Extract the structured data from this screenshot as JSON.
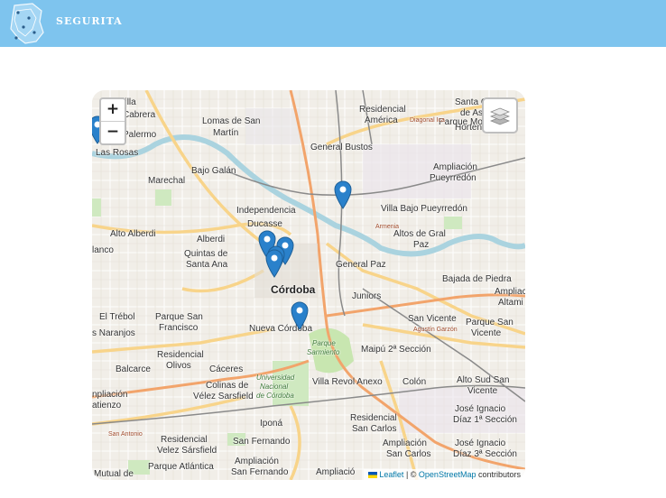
{
  "header": {
    "brand": "SEGURITA",
    "bg_color": "#7ec4ee"
  },
  "map": {
    "zoom_in_label": "+",
    "zoom_out_label": "−",
    "layers_icon": "layers-icon",
    "labels": {
      "villa": "Villa",
      "cabrera": "Cabrera",
      "palermo": "Palermo",
      "lomas": "Lomas de San",
      "martin": "Martín",
      "las_rosas": "Las Rosas",
      "bajo_galan": "Bajo Galán",
      "marechal": "Marechal",
      "residencial_america_1": "Residencial",
      "residencial_america_2": "América",
      "santa_catalina": "Santa C",
      "de_as": "de As",
      "horten": "Horten",
      "general_bustos": "General Bustos",
      "parque_montecristo": "Parque Montecristo",
      "ampliacion": "Ampliación",
      "pueyrredon": "Pueyrredón",
      "independencia": "Independencia",
      "ducasse": "Ducasse",
      "villa_bajo_pueyrredon": "Villa Bajo Pueyrredón",
      "alto_alberdi": "Alto Alberdi",
      "alberdi": "Alberdi",
      "blanco": "lanco",
      "quintas_1": "Quintas de",
      "quintas_2": "Santa Ana",
      "altos_gral_1": "Altos de Gral",
      "altos_gral_2": "Paz",
      "general_paz": "General Paz",
      "bajada": "Bajada de Piedra",
      "cordoba": "Córdoba",
      "juniors": "Juniors",
      "alta_amp_1": "Ampliac",
      "alta_amp_2": "Altami",
      "el_trebol": "El Trébol",
      "parque_san_1": "Parque San",
      "parque_san_2": "Francisco",
      "nueva_cordoba": "Nueva Córdoba",
      "san_vicente": "San Vicente",
      "parque_sv_1": "Parque San",
      "parque_sv_2": "Vicente",
      "naranjos": "s Naranjos",
      "maipu": "Maipú 2ª Sección",
      "residencial_olivos_1": "Residencial",
      "residencial_olivos_2": "Olivos",
      "balcarce": "Balcarce",
      "caceres": "Cáceres",
      "colinas_1": "Colinas de",
      "colinas_2": "Vélez Sarsfield",
      "ampliacion_w": "npliación",
      "atienzo": "atienzo",
      "villa_revol": "Villa Revol Anexo",
      "colon": "Colón",
      "alto_sud_1": "Alto Sud San",
      "alto_sud_2": "Vicente",
      "jose_ign_1": "José Ignacio",
      "jose_ign_2": "Díaz 1ª Sección",
      "ipona": "Iponá",
      "residencial_velez_1": "Residencial",
      "residencial_velez_2": "Velez Sársfield",
      "residencial_sc_1": "Residencial",
      "residencial_sc_2": "San Carlos",
      "ampl_sc_1": "Ampliación",
      "ampl_sc_2": "San Carlos",
      "jose_ign3_1": "José Ignacio",
      "jose_ign3_2": "Díaz 3ª Sección",
      "san_fernando": "San Fernando",
      "parque_atlantica": "Parque Atlántica",
      "ampl_sf_1": "Ampliación",
      "ampl_sf_2": "San Fernando",
      "mutual": "Mutual de",
      "ampliacion_bottom": "Ampliació",
      "parque_sarmiento_1": "Parque",
      "parque_sarmiento_2": "Sarmiento",
      "universidad_1": "Universidad",
      "universidad_2": "Nacional",
      "universidad_3": "de Córdoba",
      "armenia": "Armenia",
      "agustin_garzon": "Agustín Garzón",
      "diagonal_ica": "Diagonal Ica",
      "san_antonio": "San Antonio"
    },
    "attribution": {
      "leaflet": "Leaflet",
      "separator": " | © ",
      "osm": "OpenStreetMap",
      "suffix": " contributors"
    }
  }
}
